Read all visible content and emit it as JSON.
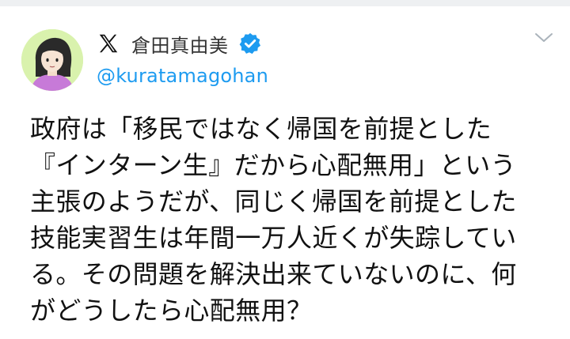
{
  "author": {
    "display_name": "倉田真由美",
    "handle": "@kuratamagohan",
    "avatar_icon": "user-avatar-illustration",
    "platform_icon": "x-logo-icon",
    "verified_icon": "verified-badge-icon"
  },
  "menu": {
    "icon": "chevron-down-icon"
  },
  "tweet": {
    "text": "政府は「移民ではなく帰国を前提とした\n『インターン生』だから心配無用」という\n主張のようだが、同じく帰国を前提とした\n技能実習生は年間一万人近くが失踪してい\nる。その問題を解決出来ていないのに、何\nがどうしたら心配無用？"
  },
  "colors": {
    "link": "#1d9bf0",
    "verified": "#1d9bf0",
    "text": "#111111"
  }
}
